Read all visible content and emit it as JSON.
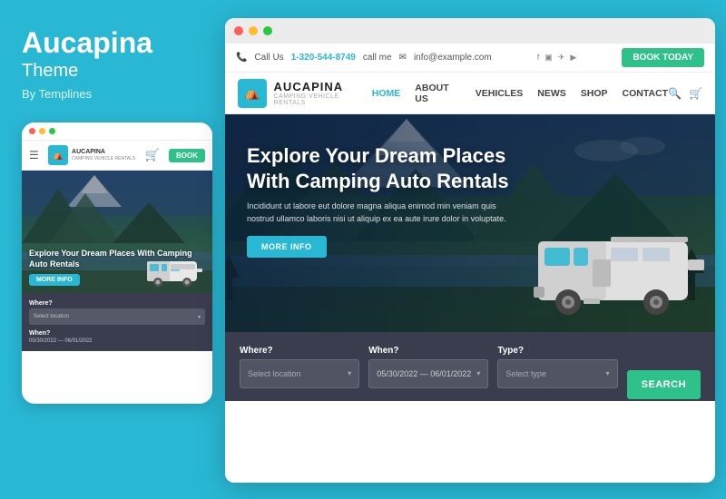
{
  "left": {
    "brand_name": "Aucapina",
    "brand_theme": "Theme",
    "brand_by": "By Templines",
    "mobile": {
      "dots": [
        "#ff5f57",
        "#ffbd2e",
        "#28c840"
      ],
      "nav": {
        "logo_text": "AUCAPINA",
        "logo_sub": "CAMPING VEHICLE RENTALS",
        "book_btn": "BOOK"
      },
      "hero": {
        "title": "Explore Your Dream Places With Camping Auto Rentals",
        "more_btn": "MORE INFO"
      },
      "form": {
        "where_label": "Where?",
        "where_placeholder": "Select location",
        "when_label": "When?",
        "date_value": "05/30/2022 — 06/01/2022"
      }
    }
  },
  "desktop": {
    "window_dots": [
      "#ff5f57",
      "#ffbd2e",
      "#28c840"
    ],
    "topbar": {
      "call_label": "Call Us",
      "phone": "1-320-544-8749",
      "call_me": "call me",
      "email": "info@example.com",
      "book_btn": "BOOK TODAY"
    },
    "nav": {
      "logo_text": "AUCAPINA",
      "logo_sub": "CAMPING VEHICLE RENTALS",
      "links": [
        "HOME",
        "ABOUT US",
        "VEHICLES",
        "NEWS",
        "SHOP",
        "CONTACT"
      ]
    },
    "hero": {
      "title": "Explore Your Dream Places With Camping Auto Rentals",
      "desc": "Incididunt ut labore eut dolore magna aliqua enimod min veniam quis nostrud ullamco laboris nisi ut aliquip ex ea aute irure dolor in voluptate.",
      "more_btn": "MORE INFO"
    },
    "search": {
      "where_label": "Where?",
      "where_placeholder": "Select location",
      "when_label": "When?",
      "date_value": "05/30/2022 — 06/01/2022",
      "type_label": "Type?",
      "type_placeholder": "Select type",
      "search_btn": "SEARCH"
    }
  }
}
